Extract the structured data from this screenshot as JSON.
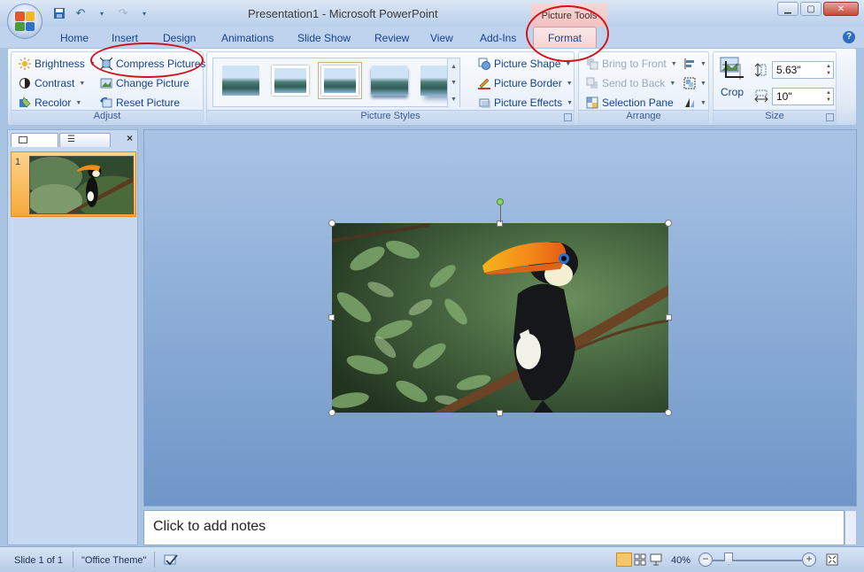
{
  "window": {
    "title": "Presentation1 - Microsoft PowerPoint",
    "context_tab_group": "Picture Tools",
    "controls": [
      "minimize",
      "maximize",
      "close"
    ]
  },
  "quick_access": {
    "items": [
      {
        "name": "save",
        "icon": "floppy-disk-icon"
      },
      {
        "name": "undo",
        "icon": "undo-icon"
      },
      {
        "name": "redo",
        "icon": "redo-icon"
      },
      {
        "name": "customize",
        "icon": "dropdown-icon"
      }
    ]
  },
  "tabs": [
    {
      "label": "Home"
    },
    {
      "label": "Insert"
    },
    {
      "label": "Design"
    },
    {
      "label": "Animations"
    },
    {
      "label": "Slide Show"
    },
    {
      "label": "Review"
    },
    {
      "label": "View"
    },
    {
      "label": "Add-Ins"
    },
    {
      "label": "Format",
      "active": true
    }
  ],
  "ribbon": {
    "adjust": {
      "label": "Adjust",
      "brightness": "Brightness",
      "contrast": "Contrast",
      "recolor": "Recolor",
      "compress": "Compress Pictures",
      "change": "Change Picture",
      "reset": "Reset Picture"
    },
    "picture_styles": {
      "label": "Picture Styles",
      "shape": "Picture Shape",
      "border": "Picture Border",
      "effects": "Picture Effects"
    },
    "arrange": {
      "label": "Arrange",
      "bring_front": "Bring to Front",
      "send_back": "Send to Back",
      "selection_pane": "Selection Pane"
    },
    "size": {
      "label": "Size",
      "crop": "Crop",
      "height": "5.63\"",
      "width": "10\""
    }
  },
  "slides_pane": {
    "slide_number": "1"
  },
  "notes": {
    "placeholder": "Click to add notes"
  },
  "status": {
    "slide": "Slide 1 of 1",
    "theme": "\"Office Theme\"",
    "zoom": "40%"
  },
  "colors": {
    "annotation": "#d0141c",
    "context_tab": "#f5d3d3"
  }
}
